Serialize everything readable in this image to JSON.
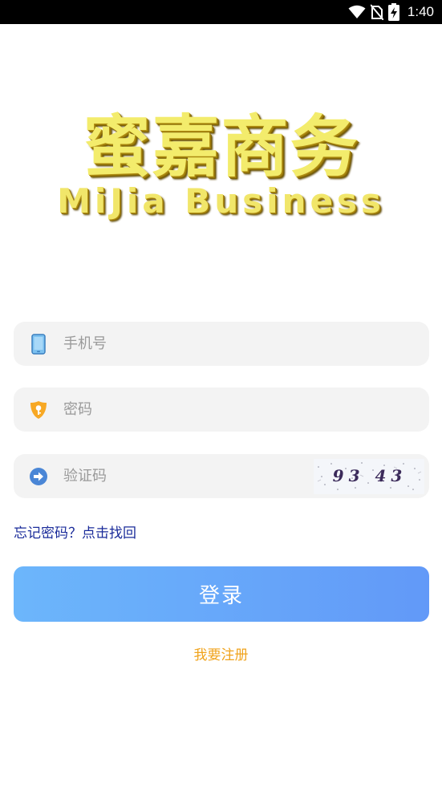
{
  "status_bar": {
    "time": "1:40",
    "icons": [
      "wifi-icon",
      "no-sim-icon",
      "battery-charging-icon"
    ]
  },
  "logo": {
    "title_cn": "蜜嘉商务",
    "title_en": "MiJia Business",
    "colors": {
      "fill": "#f3ec6c",
      "shadow": "#7c6005"
    }
  },
  "form": {
    "phone": {
      "placeholder": "手机号",
      "value": "",
      "icon": "phone-icon"
    },
    "password": {
      "placeholder": "密码",
      "value": "",
      "icon": "key-shield-icon"
    },
    "captcha": {
      "placeholder": "验证码",
      "value": "",
      "icon": "arrow-right-circle-icon",
      "image_text": "93 43"
    },
    "forgot_label": "忘记密码？点击找回",
    "login_label": "登录",
    "register_label": "我要注册"
  },
  "colors": {
    "button_gradient_start": "#6cb6fb",
    "button_gradient_end": "#6299f8",
    "link_blue": "#1a2b9a",
    "link_orange": "#f0a31c",
    "field_bg": "#f3f3f3"
  }
}
